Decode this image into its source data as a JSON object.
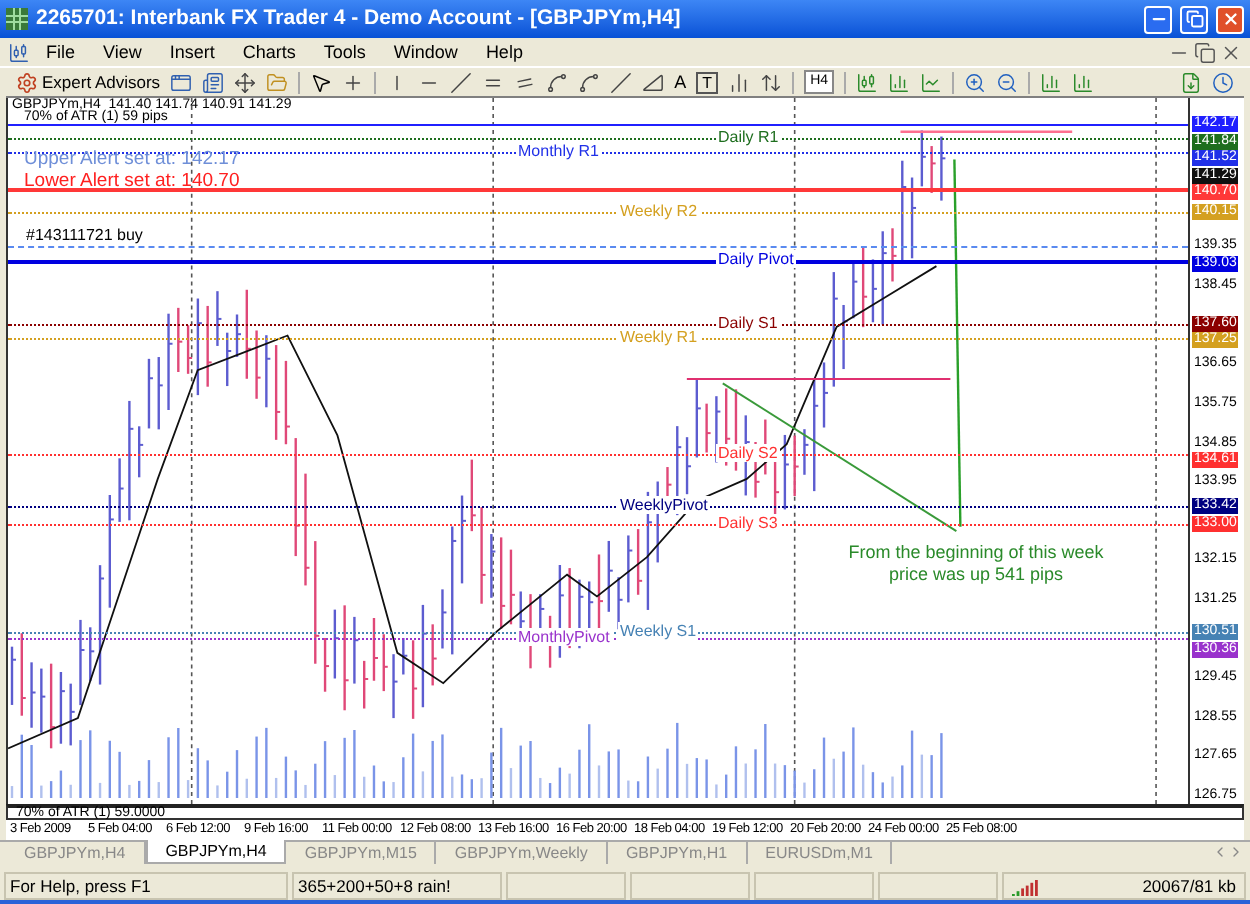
{
  "window": {
    "title": "2265701: Interbank FX Trader 4 - Demo Account - [GBPJPYm,H4]"
  },
  "menu": [
    "File",
    "View",
    "Insert",
    "Charts",
    "Tools",
    "Window",
    "Help"
  ],
  "toolbar": {
    "expert_advisors": "Expert Advisors",
    "text_tool": "A",
    "label_tool": "T",
    "period": "H4"
  },
  "chart": {
    "header": "GBPJPYm,H4  141.40 141.74 140.91 141.29",
    "atr_label": "70% of ATR (1) 59 pips",
    "alerts": [
      {
        "text": "Upper Alert set at: 142.17",
        "color": "#6f8fd8"
      },
      {
        "text": "Lower Alert set at: 140.70",
        "color": "#ff2020"
      }
    ],
    "levels": [
      {
        "price": "142.17",
        "color": "#2020ff",
        "kind": "alert",
        "thick": false,
        "boxed": true
      },
      {
        "price": "141.84",
        "color": "#1e6e1e",
        "kind": "daily",
        "thick": false,
        "boxed": true,
        "label": "Daily R1"
      },
      {
        "price": "141.52",
        "color": "#2030e8",
        "kind": "monthly",
        "thick": false,
        "boxed": true,
        "label": "Monthly R1"
      },
      {
        "price": "141.29",
        "color": "#101010",
        "kind": "price",
        "thick": false,
        "boxed": true
      },
      {
        "price": "140.70",
        "color": "#ff3838",
        "kind": "alert",
        "thick": true,
        "boxed": true
      },
      {
        "price": "140.15",
        "color": "#d4a020",
        "kind": "weekly",
        "thick": false,
        "boxed": true,
        "label": "Weekly R2"
      },
      {
        "price": "139.35",
        "color": "#5a8af0",
        "kind": "order",
        "thick": false,
        "boxed": false,
        "label": "#143111721 buy"
      },
      {
        "price": "139.03",
        "color": "#0000e0",
        "kind": "daily",
        "thick": true,
        "boxed": true,
        "label": "Daily Pivot"
      },
      {
        "price": "137.60",
        "color": "#8b0000",
        "kind": "daily",
        "thick": false,
        "boxed": true,
        "label": "Daily S1"
      },
      {
        "price": "137.25",
        "color": "#d4a020",
        "kind": "weekly",
        "thick": false,
        "boxed": true,
        "label": "Weekly R1"
      },
      {
        "price": "134.61",
        "color": "#ff3030",
        "kind": "daily",
        "thick": false,
        "boxed": true,
        "label": "Daily S2"
      },
      {
        "price": "133.42",
        "color": "#000080",
        "kind": "weekly",
        "thick": false,
        "boxed": true,
        "label": "WeeklyPivot"
      },
      {
        "price": "133.00",
        "color": "#ff3030",
        "kind": "daily",
        "thick": false,
        "boxed": true,
        "label": "Daily S3"
      },
      {
        "price": "130.51",
        "color": "#4682b4",
        "kind": "weekly",
        "thick": false,
        "boxed": true,
        "label": "Weekly S1"
      },
      {
        "price": "130.36",
        "color": "#9932cc",
        "kind": "monthly",
        "thick": false,
        "boxed": true,
        "label": "MonthlyPivot"
      }
    ],
    "price_ticks": [
      "138.45",
      "136.65",
      "135.75",
      "134.85",
      "133.95",
      "132.15",
      "131.25",
      "129.45",
      "128.55",
      "127.65",
      "126.75"
    ],
    "annotation": "From the beginning of this week price was up 541 pips",
    "indicator_label": "70% of ATR (1) 59.0000",
    "dates": [
      "3 Feb 2009",
      "5 Feb 04:00",
      "6 Feb 12:00",
      "9 Feb 16:00",
      "11 Feb 00:00",
      "12 Feb 08:00",
      "13 Feb 16:00",
      "16 Feb 20:00",
      "18 Feb 04:00",
      "19 Feb 12:00",
      "20 Feb 20:00",
      "24 Feb 00:00",
      "25 Feb 08:00"
    ]
  },
  "tabs": [
    {
      "label": "GBPJPYm,H4",
      "selected": false
    },
    {
      "label": "GBPJPYm,H4",
      "selected": true
    },
    {
      "label": "GBPJPYm,M15",
      "selected": false
    },
    {
      "label": "GBPJPYm,Weekly",
      "selected": false
    },
    {
      "label": "GBPJPYm,H1",
      "selected": false
    },
    {
      "label": "EURUSDm,M1",
      "selected": false
    }
  ],
  "status_bar": {
    "help": "For Help, press F1",
    "profile": "365+200+50+8 rain!",
    "traffic": "20067/81 kb"
  }
}
